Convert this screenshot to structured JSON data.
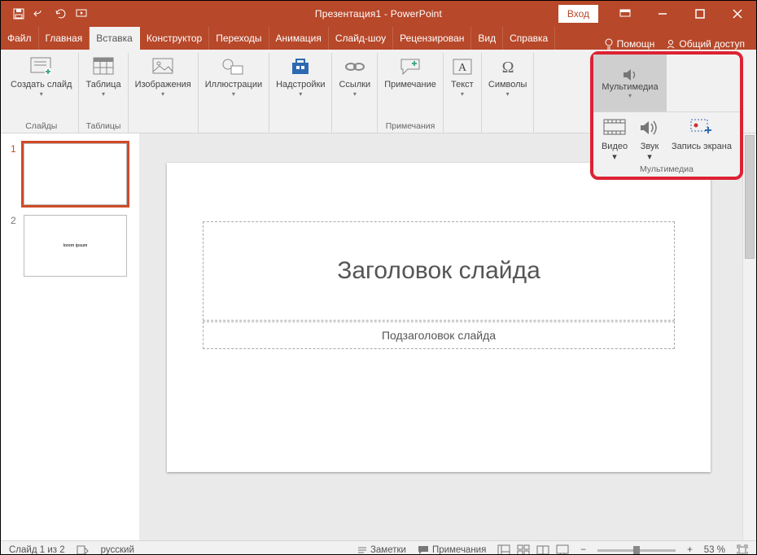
{
  "titlebar": {
    "title": "Презентация1 - PowerPoint",
    "login": "Вход"
  },
  "tabs": {
    "items": [
      "Файл",
      "Главная",
      "Вставка",
      "Конструктор",
      "Переходы",
      "Анимация",
      "Слайд-шоу",
      "Рецензирован",
      "Вид",
      "Справка"
    ],
    "active_index": 2,
    "help": "Помощн",
    "share": "Общий доступ"
  },
  "ribbon": {
    "slides": {
      "new_slide": "Создать слайд",
      "group_label": "Слайды"
    },
    "tables": {
      "table": "Таблица",
      "group_label": "Таблицы"
    },
    "images": {
      "label": "Изображения"
    },
    "illustrations": {
      "label": "Иллюстрации"
    },
    "addins": {
      "label": "Надстройки"
    },
    "links": {
      "label": "Ссылки"
    },
    "comments": {
      "label": "Примечание",
      "group_label": "Примечания"
    },
    "text": {
      "label": "Текст"
    },
    "symbols": {
      "label": "Символы"
    },
    "multimedia": {
      "label": "Мультимедиа",
      "video": "Видео",
      "audio": "Звук",
      "screenrec": "Запись экрана",
      "group_label": "Мультимедиа"
    }
  },
  "thumbs": [
    {
      "num": "1",
      "selected": true
    },
    {
      "num": "2",
      "selected": false,
      "preview": "lorem ipsum"
    }
  ],
  "slide": {
    "title_placeholder": "Заголовок слайда",
    "subtitle_placeholder": "Подзаголовок слайда"
  },
  "status": {
    "slide_count": "Слайд 1 из 2",
    "language": "русский",
    "notes": "Заметки",
    "comments": "Примечания",
    "zoom": "53 %"
  }
}
